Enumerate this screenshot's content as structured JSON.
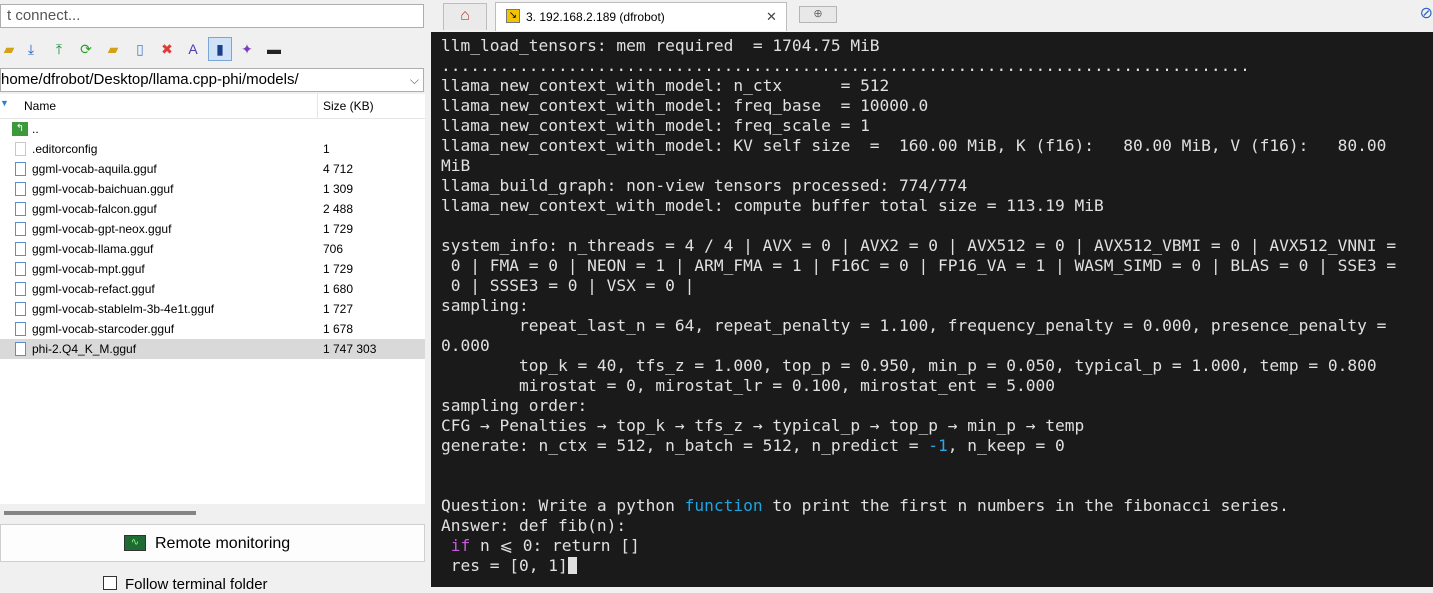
{
  "left_panel": {
    "connect_text": "t connect...",
    "toolbar_icons": [
      "open-folder-icon",
      "download-icon",
      "upload-icon",
      "refresh-icon",
      "new-folder-icon",
      "new-file-icon",
      "delete-icon",
      "rename-icon",
      "bookmark-icon",
      "wand-icon",
      "terminal-icon"
    ],
    "path": "home/dfrobot/Desktop/llama.cpp-phi/models/",
    "columns": {
      "name": "Name",
      "size": "Size (KB)"
    },
    "files": [
      {
        "name": "..",
        "size": "",
        "type": "up"
      },
      {
        "name": ".editorconfig",
        "size": "1",
        "type": "plain"
      },
      {
        "name": "ggml-vocab-aquila.gguf",
        "size": "4 712",
        "type": "file"
      },
      {
        "name": "ggml-vocab-baichuan.gguf",
        "size": "1 309",
        "type": "file"
      },
      {
        "name": "ggml-vocab-falcon.gguf",
        "size": "2 488",
        "type": "file"
      },
      {
        "name": "ggml-vocab-gpt-neox.gguf",
        "size": "1 729",
        "type": "file"
      },
      {
        "name": "ggml-vocab-llama.gguf",
        "size": "706",
        "type": "file"
      },
      {
        "name": "ggml-vocab-mpt.gguf",
        "size": "1 729",
        "type": "file"
      },
      {
        "name": "ggml-vocab-refact.gguf",
        "size": "1 680",
        "type": "file"
      },
      {
        "name": "ggml-vocab-stablelm-3b-4e1t.gguf",
        "size": "1 727",
        "type": "file"
      },
      {
        "name": "ggml-vocab-starcoder.gguf",
        "size": "1 678",
        "type": "file"
      },
      {
        "name": "phi-2.Q4_K_M.gguf",
        "size": "1 747 303",
        "type": "file",
        "selected": true
      }
    ],
    "remote_button": "Remote monitoring",
    "follow_label": "Follow terminal folder"
  },
  "tabs": {
    "active_label": "3. 192.168.2.189 (dfrobot)",
    "close": "✕",
    "home_icon": "home-icon",
    "new_tab_icon": "new-tab-icon"
  },
  "terminal": {
    "lines": [
      "llm_load_tensors: mem required  = 1704.75 MiB",
      "...................................................................................",
      "llama_new_context_with_model: n_ctx      = 512",
      "llama_new_context_with_model: freq_base  = 10000.0",
      "llama_new_context_with_model: freq_scale = 1",
      "llama_new_context_with_model: KV self size  =  160.00 MiB, K (f16):   80.00 MiB, V (f16):   80.00",
      "MiB",
      "llama_build_graph: non-view tensors processed: 774/774",
      "llama_new_context_with_model: compute buffer total size = 113.19 MiB",
      "",
      "system_info: n_threads = 4 / 4 | AVX = 0 | AVX2 = 0 | AVX512 = 0 | AVX512_VBMI = 0 | AVX512_VNNI =",
      " 0 | FMA = 0 | NEON = 1 | ARM_FMA = 1 | F16C = 0 | FP16_VA = 1 | WASM_SIMD = 0 | BLAS = 0 | SSE3 =",
      " 0 | SSSE3 = 0 | VSX = 0 |",
      "sampling:",
      "        repeat_last_n = 64, repeat_penalty = 1.100, frequency_penalty = 0.000, presence_penalty =",
      "0.000",
      "        top_k = 40, tfs_z = 1.000, top_p = 0.950, min_p = 0.050, typical_p = 1.000, temp = 0.800",
      "        mirostat = 0, mirostat_lr = 0.100, mirostat_ent = 5.000",
      "sampling order:",
      "CFG → Penalties → top_k → tfs_z → typical_p → top_p → min_p → temp"
    ],
    "generate": {
      "pre": "generate: n_ctx = 512, n_batch = 512, n_predict = ",
      "neg": "-1",
      "post": ", n_keep = 0"
    },
    "question": {
      "pre": "Question: Write a python ",
      "kw": "function",
      "post": " to print the first n numbers in the fibonacci series."
    },
    "answer": "Answer: def fib(n):",
    "if_line": {
      "kw": "if",
      "rest": " n ⩽ 0: return []"
    },
    "res_line": " res = [0, 1]"
  }
}
